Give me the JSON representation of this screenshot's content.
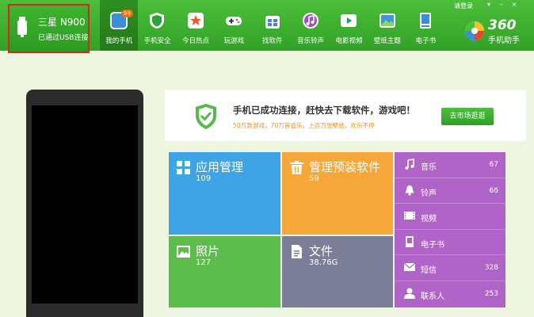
{
  "device": {
    "name": "三星 N900",
    "status": "已通过USB连接"
  },
  "nav": [
    {
      "key": "my-phone",
      "label": "我的手机",
      "badge": "99",
      "color": "#3a8fd8",
      "active": true
    },
    {
      "key": "security",
      "label": "手机安全",
      "color": "#2fa13a"
    },
    {
      "key": "hot",
      "label": "今日热点",
      "color": "#f05a28"
    },
    {
      "key": "games",
      "label": "玩游戏",
      "color": "#333333"
    },
    {
      "key": "software",
      "label": "找软件",
      "color": "#4b7fd0"
    },
    {
      "key": "music",
      "label": "音乐铃声",
      "color": "#a24fc6"
    },
    {
      "key": "video",
      "label": "电影视频",
      "color": "#18a15a"
    },
    {
      "key": "wallpaper",
      "label": "壁纸主题",
      "color": "#3a9ad9"
    },
    {
      "key": "ebook",
      "label": "电子书",
      "color": "#3b8fd8"
    }
  ],
  "header": {
    "login": "请登录",
    "logo_num": "360",
    "logo_sub": "手机助手"
  },
  "banner": {
    "title": "手机已成功连接，赶快去下载软件，游戏吧！",
    "subtitle": "50万款游戏，70万首音乐，上百万张壁纸，欢乐不停",
    "button": "去市场逛逛"
  },
  "tiles": [
    {
      "key": "apps",
      "name": "应用管理",
      "count": "109",
      "color": "#3ea4e6"
    },
    {
      "key": "preinstalled",
      "name": "管理预装软件",
      "count": "59",
      "color": "#f6a73a"
    },
    {
      "key": "photos",
      "name": "照片",
      "count": "127",
      "color": "#5cbc4c"
    },
    {
      "key": "files",
      "name": "文件",
      "count": "38.76G",
      "color": "#7b7e96"
    }
  ],
  "media": [
    {
      "key": "music",
      "label": "音乐",
      "count": "67"
    },
    {
      "key": "ringtone",
      "label": "铃声",
      "count": "66"
    },
    {
      "key": "video",
      "label": "视频",
      "count": ""
    },
    {
      "key": "ebook",
      "label": "电子书",
      "count": ""
    },
    {
      "key": "sms",
      "label": "短信",
      "count": "328"
    },
    {
      "key": "contacts",
      "label": "联系人",
      "count": "253"
    }
  ]
}
